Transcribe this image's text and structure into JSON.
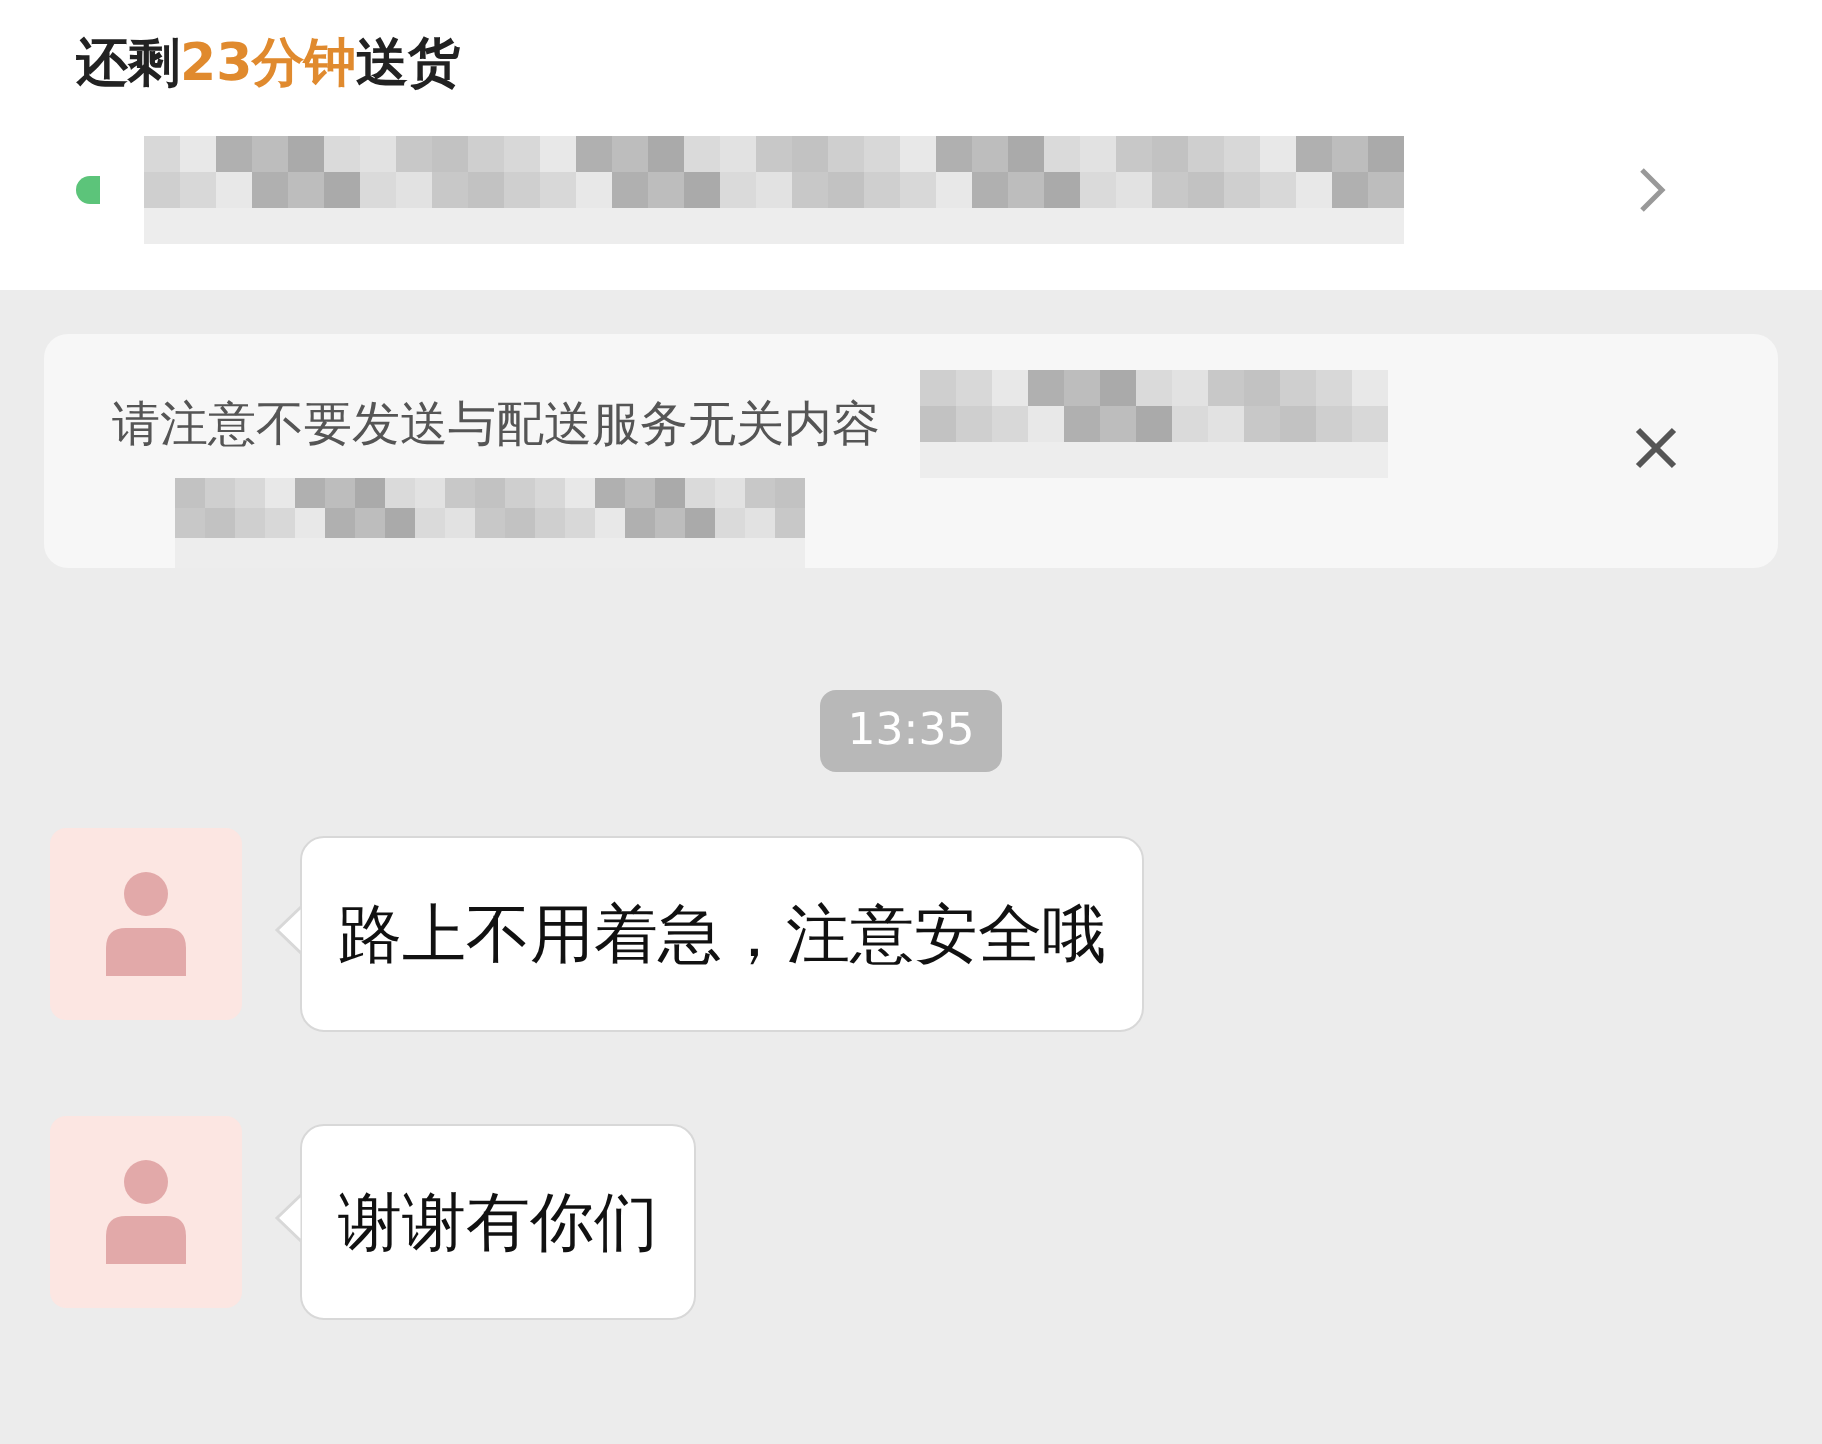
{
  "header": {
    "title_parts": [
      {
        "text": "还剩",
        "highlight": false
      },
      {
        "text": "23分钟",
        "highlight": true
      },
      {
        "text": "送货",
        "highlight": false
      }
    ]
  },
  "notice": {
    "text": "请注意不要发送与配送服务无关内容"
  },
  "timestamp": "13:35",
  "messages": [
    {
      "text": "路上不用着急，注意安全哦"
    },
    {
      "text": "谢谢有你们"
    }
  ]
}
